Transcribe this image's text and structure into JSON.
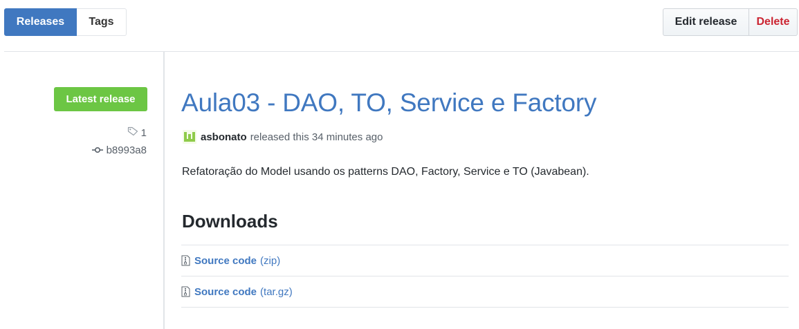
{
  "subnav": {
    "releases_label": "Releases",
    "tags_label": "Tags"
  },
  "actions": {
    "edit_label": "Edit release",
    "delete_label": "Delete"
  },
  "meta": {
    "badge": "Latest release",
    "tag_count": "1",
    "commit": "b8993a8"
  },
  "release": {
    "title": "Aula03 - DAO, TO, Service e Factory",
    "author": "asbonato",
    "released_text": "released this 34 minutes ago",
    "description": "Refatoração do Model usando os patterns DAO, Factory, Service e TO (Javabean)."
  },
  "downloads": {
    "heading": "Downloads",
    "items": [
      {
        "label": "Source code",
        "format": "(zip)"
      },
      {
        "label": "Source code",
        "format": "(tar.gz)"
      }
    ]
  },
  "colors": {
    "accent": "#4078c0",
    "badge_green": "#6cc644",
    "delete_red": "#cb2431"
  }
}
